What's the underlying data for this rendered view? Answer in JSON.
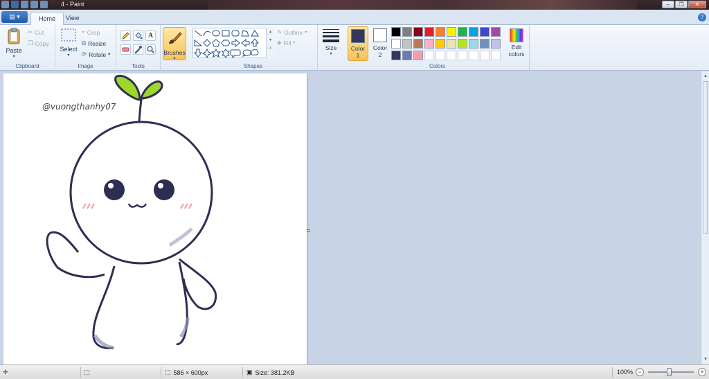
{
  "window": {
    "title": "4 - Paint",
    "minimize": "‒",
    "restore": "❐",
    "close": "✕"
  },
  "tabs": {
    "app_menu": "▤ ▾",
    "home": "Home",
    "view": "View",
    "help": "?"
  },
  "ribbon": {
    "clipboard": {
      "label": "Clipboard",
      "paste": "Paste",
      "cut": "Cut",
      "copy": "Copy"
    },
    "image": {
      "label": "Image",
      "select": "Select",
      "crop": "Crop",
      "resize": "Resize",
      "rotate": "Rotate"
    },
    "tools": {
      "label": "Tools",
      "text_glyph": "A"
    },
    "brushes": {
      "label": "Brushes"
    },
    "shapes": {
      "label": "Shapes",
      "outline": "Outline",
      "fill": "Fill"
    },
    "size": {
      "label": "Size"
    },
    "colors": {
      "label": "Colors",
      "color1": "Color",
      "color1_num": "1",
      "color2": "Color",
      "color2_num": "2",
      "edit_colors_1": "Edit",
      "edit_colors_2": "colors",
      "color1_value": "#35375a",
      "color2_value": "#ffffff",
      "palette_row1": [
        "#000000",
        "#7f7f7f",
        "#880015",
        "#ed1c24",
        "#ff7f27",
        "#fff200",
        "#22b14c",
        "#00a2e8",
        "#3f48cc",
        "#a349a4"
      ],
      "palette_row2": [
        "#ffffff",
        "#c3c3c3",
        "#b97a57",
        "#ffaec9",
        "#ffc90e",
        "#efe4b0",
        "#b5e61d",
        "#99d9ea",
        "#7092be",
        "#c8bfe7"
      ],
      "palette_row3": [
        "#35375a",
        "#6f7bb0",
        "#f4a0a8",
        "",
        "",
        "",
        "",
        "",
        "",
        ""
      ]
    }
  },
  "canvas": {
    "signature": "@vuongthanhy07"
  },
  "status": {
    "dimensions": "586 × 600px",
    "size": "Size: 381.2KB",
    "zoom": "100%"
  }
}
